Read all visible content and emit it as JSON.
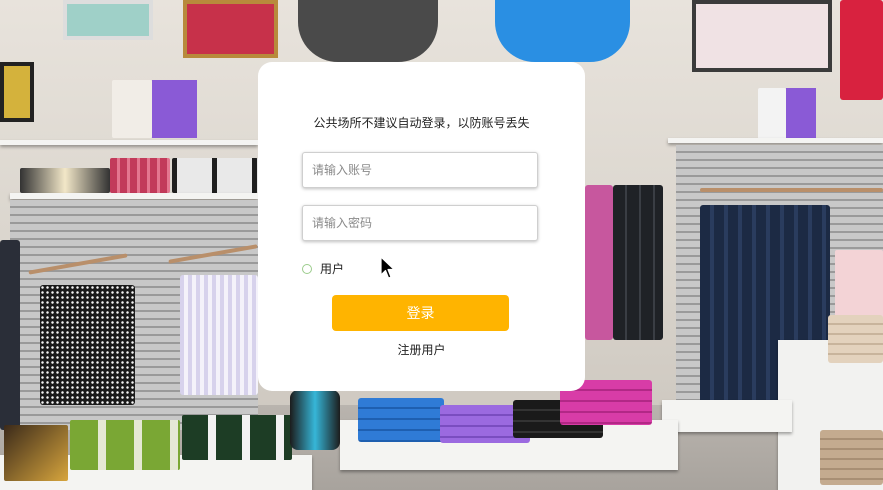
{
  "login_dialog": {
    "notice": "公共场所不建议自动登录，以防账号丢失",
    "account_placeholder": "请输入账号",
    "password_placeholder": "请输入密码",
    "role_option_label": "用户",
    "login_button": "登录",
    "register_link": "注册用户"
  },
  "colors": {
    "login_button": "#ffb400",
    "radio_border": "#9ccc8c",
    "dialog_background": "#ffffff"
  },
  "icons": {
    "pointer": "mouse-pointer-icon"
  }
}
